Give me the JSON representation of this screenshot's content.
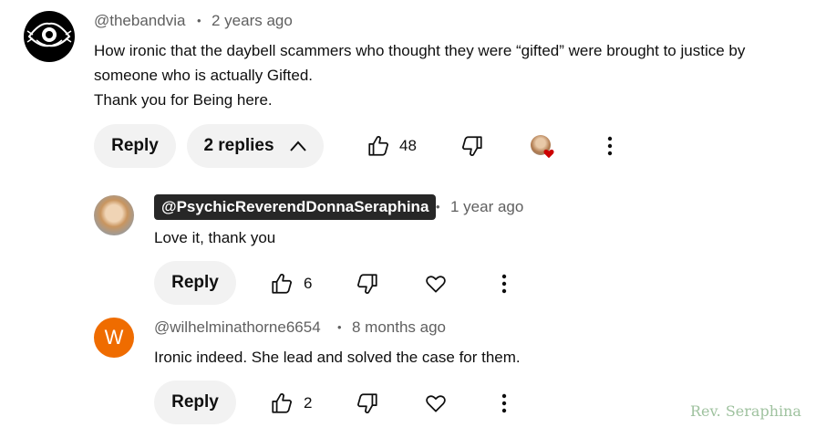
{
  "comment": {
    "author": "@thebandvia",
    "separator": "•",
    "time": "2 years ago",
    "lines": [
      "How ironic that the daybell scammers who thought they were “gifted” were brought to justice by",
      "someone who is actually Gifted.",
      "Thank you for Being here."
    ],
    "reply_label": "Reply",
    "replies_label": "2 replies",
    "like_count": "48"
  },
  "replies": [
    {
      "author": "@PsychicReverendDonnaSeraphina",
      "separator": "•",
      "time": "1 year ago",
      "text": "Love it, thank you",
      "reply_label": "Reply",
      "like_count": "6"
    },
    {
      "author": "@wilhelminathorne6654",
      "avatar_letter": "W",
      "avatar_color": "#ef6c00",
      "separator": "•",
      "time": "8 months ago",
      "text": "Ironic indeed. She lead and solved the case for them.",
      "reply_label": "Reply",
      "like_count": "2"
    }
  ],
  "watermark": "Rev. Seraphina",
  "icons": [
    "eye-logo-avatar",
    "thumbs-up-icon",
    "thumbs-down-icon",
    "chevron-up-icon",
    "creator-heart-icon",
    "heart-icon",
    "more-vert-icon"
  ],
  "colors": {
    "heart": "#cc0000",
    "pill_bg": "#f2f2f2",
    "chip_bg": "#272727",
    "muted": "#606060"
  }
}
